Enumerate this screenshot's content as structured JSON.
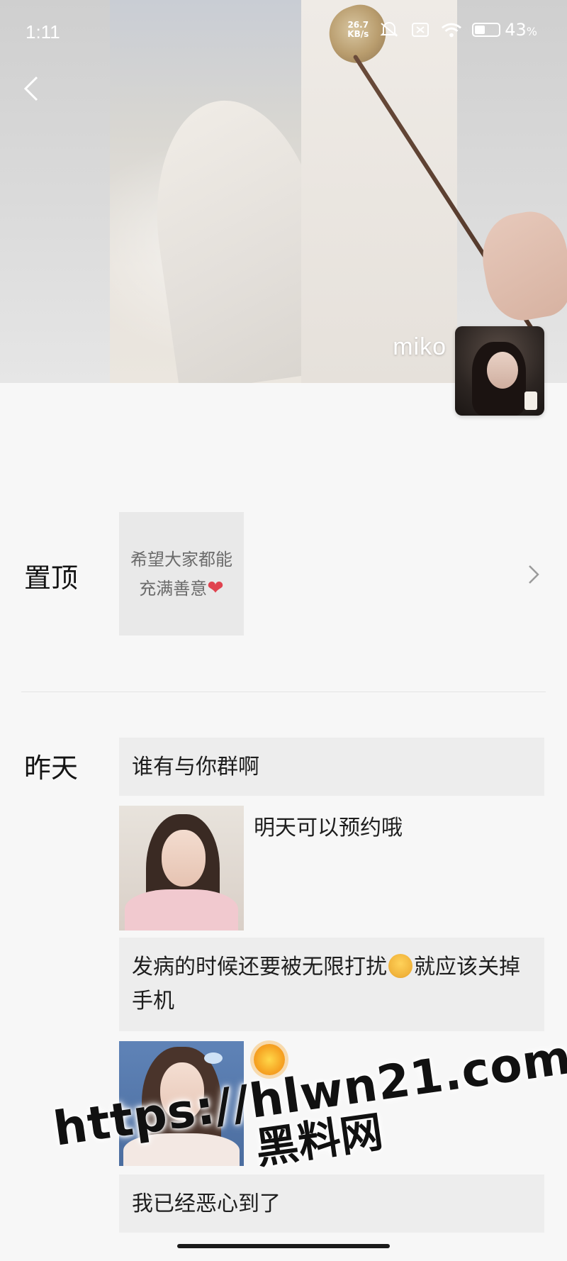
{
  "status_bar": {
    "time": "1:11",
    "net_speed_value": "26.7",
    "net_speed_unit": "KB/s",
    "battery_percent": "43",
    "battery_suffix": "%",
    "battery_level": 0.43
  },
  "profile": {
    "name": "miko"
  },
  "pinned": {
    "label": "置顶",
    "card_line1": "希望大家都能",
    "card_line2": "充满善意",
    "heart_icon": "red-heart"
  },
  "yesterday": {
    "label": "昨天",
    "posts": [
      {
        "type": "text",
        "text": "谁有与你群啊"
      },
      {
        "type": "photo",
        "caption": "明天可以预约哦"
      },
      {
        "type": "text",
        "text_part1": "发病的时候还要被无限打扰",
        "emoji": "zipper-mouth-emoji",
        "text_part2": "就应该关掉手机"
      },
      {
        "type": "photo",
        "caption_emoji": "sun-emoji"
      },
      {
        "type": "text",
        "text": "我已经恶心到了"
      }
    ]
  },
  "watermark": {
    "url": "https://hlwn21.com",
    "cn": "黑料网"
  },
  "colors": {
    "background": "#f7f7f7",
    "post_bg": "#ededed",
    "pinned_bg": "#e9e9e9",
    "heart": "#e0434f"
  }
}
